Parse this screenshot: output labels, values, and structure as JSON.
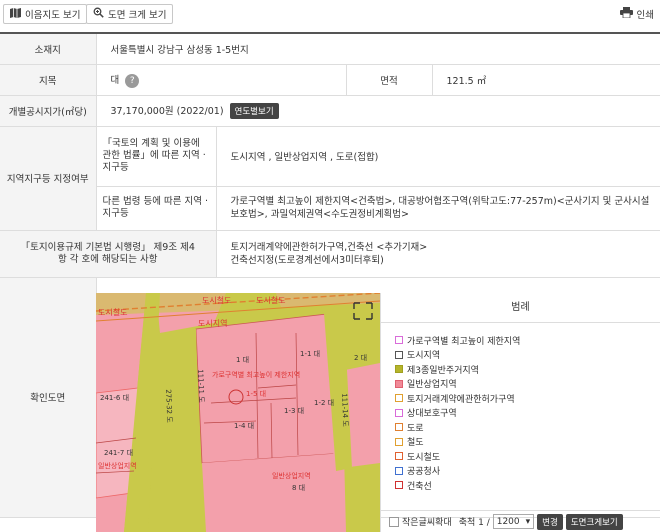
{
  "toolbar": {
    "map_btn": "이음지도 보기",
    "zoom_btn": "도면 크게 보기",
    "print_btn": "인쇄"
  },
  "info": {
    "location_label": "소재지",
    "location_value": "서울특별시 강남구 삼성동 1-5번지",
    "category_label": "지목",
    "category_value": "대",
    "area_label": "면적",
    "area_value": "121.5 ㎡",
    "price_label": "개별공시지가(㎡당)",
    "price_value": "37,170,000원 (2022/01)",
    "price_btn": "연도별보기",
    "zone_label": "지역지구등 지정여부",
    "zone_sub1_label": "「국토의 계획 및 이용에 관한 법률」에 따른 지역 · 지구등",
    "zone_sub1_value": "도시지역 , 일반상업지역 , 도로(접합)",
    "zone_sub2_label": "다른 법령 등에 따른 지역 · 지구등",
    "zone_sub2_value": "가로구역별 최고높이 제한지역<건축법>, 대공방어협조구역(위탁고도:77-257m)<군사기지 및 군사시설 보호법>, 과밀억제권역<수도권정비계획법>",
    "reg_label": "「토지이용규제 기본법 시행령」 제9조 제4항 각 호에 해당되는 사항",
    "reg_value_1": "토지거래계약에관한허가구역,건축선 <추가기재>",
    "reg_value_2": "건축선지정(도로경계선에서3미터후퇴)",
    "map_label": "확인도면"
  },
  "legend": {
    "title": "범례",
    "items": [
      {
        "label": "가로구역별 최고높이 제한지역",
        "color": "#d96bd9",
        "fill": "#ffffff"
      },
      {
        "label": "도시지역",
        "color": "#555555",
        "fill": "#ffffff"
      },
      {
        "label": "제3종일반주거지역",
        "color": "#a0a020",
        "fill": "#b5b52a"
      },
      {
        "label": "일반상업지역",
        "color": "#e06070",
        "fill": "#f08a98"
      },
      {
        "label": "토지거래계약에관한허가구역",
        "color": "#e0a030",
        "fill": "#ffffff"
      },
      {
        "label": "상대보호구역",
        "color": "#d96bd9",
        "fill": "#ffffff"
      },
      {
        "label": "도로",
        "color": "#e08030",
        "fill": "#ffffff"
      },
      {
        "label": "철도",
        "color": "#e0a030",
        "fill": "#ffffff"
      },
      {
        "label": "도시철도",
        "color": "#e06030",
        "fill": "#ffffff"
      },
      {
        "label": "공공청사",
        "color": "#4070d0",
        "fill": "#ffffff"
      },
      {
        "label": "건축선",
        "color": "#d03030",
        "fill": "#ffffff"
      }
    ]
  },
  "controls": {
    "small_text": "작은글씨확대",
    "scale_label": "축척 1 /",
    "scale_value": "1200",
    "change_btn": "변경",
    "zoom_btn": "도면크게보기"
  },
  "map": {
    "labels": {
      "l1": "도시철도",
      "l2": "도시철도",
      "l3": "도시철도",
      "l4": "1 대",
      "l5": "1-1 대",
      "l6": "2 대",
      "l7": "가로구역별 최고높이 제한지역",
      "l8": "1-5 대",
      "l9": "1-3 대",
      "l10": "1-2 대",
      "l11": "1-4 대",
      "l12": "241-6 대",
      "l13": "241-7 대",
      "l14": "일반상업지역",
      "l15": "일반상업지역",
      "l16": "8 대",
      "l17": "111-11 도",
      "l18": "275-32 도",
      "l19": "111-14 도",
      "l20": "도시지역"
    }
  }
}
